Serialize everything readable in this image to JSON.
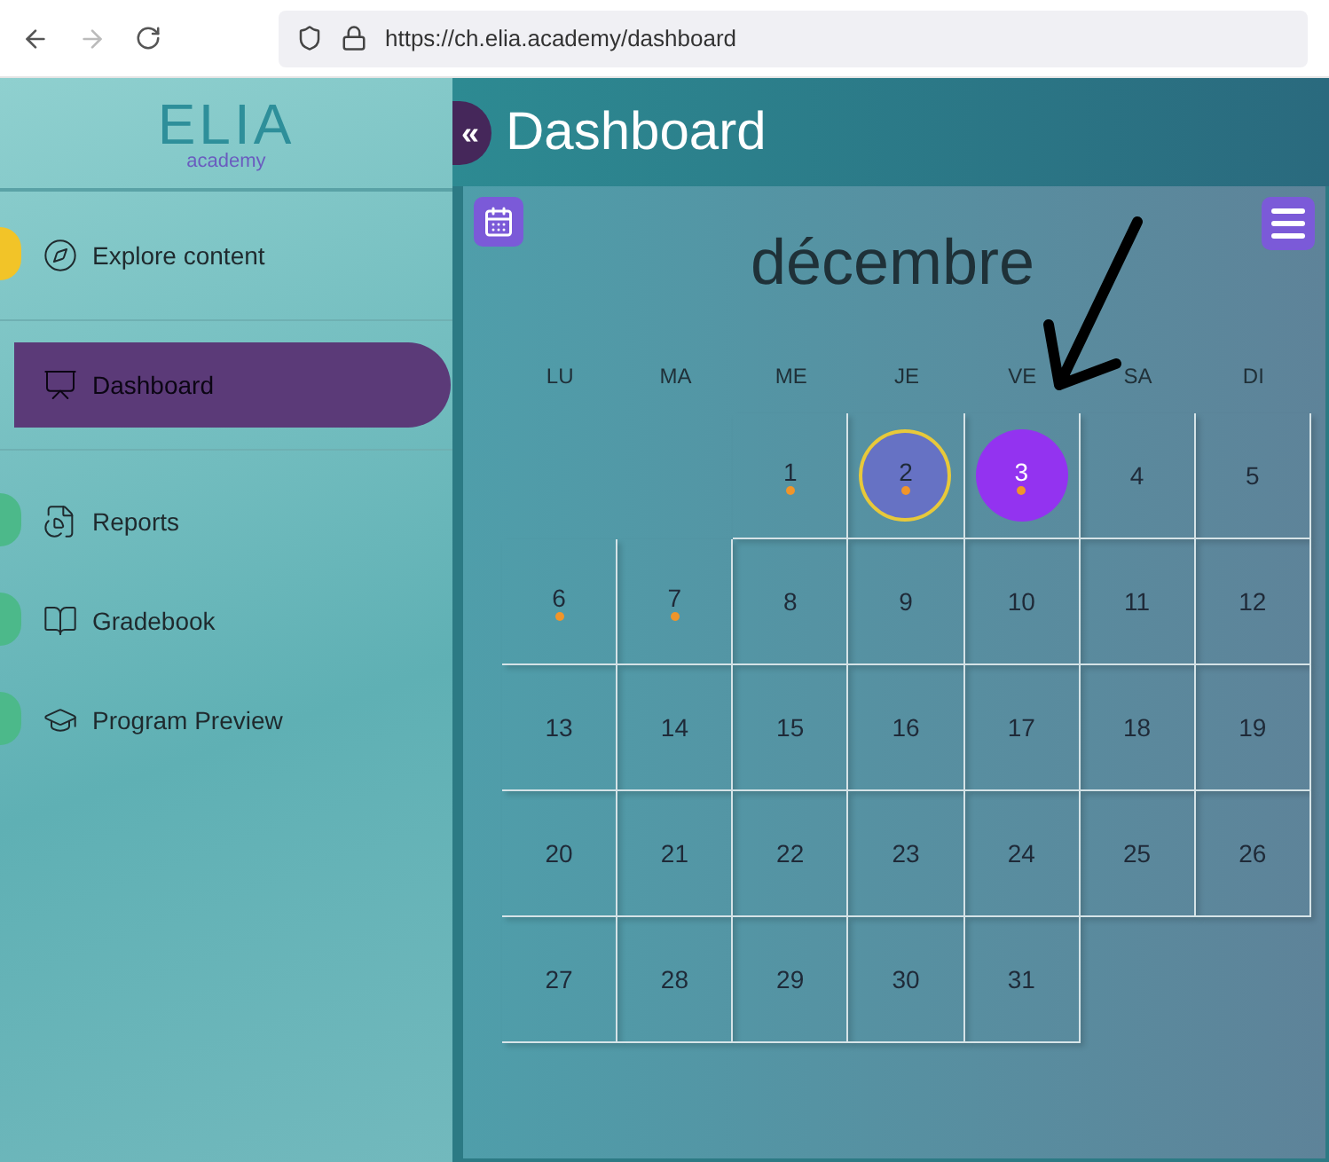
{
  "browser": {
    "url": "https://ch.elia.academy/dashboard",
    "forward_disabled": true
  },
  "sidebar": {
    "logo": {
      "name": "ELIA",
      "tagline": "academy"
    },
    "sections": [
      {
        "items": [
          {
            "label": "Explore content",
            "selected": false,
            "color": "#f2c428"
          }
        ]
      },
      {
        "items": [
          {
            "label": "Dashboard",
            "selected": true
          }
        ]
      },
      {
        "items": [
          {
            "label": "Reports",
            "selected": false,
            "color": "#4cb98a"
          },
          {
            "label": "Gradebook",
            "selected": false,
            "color": "#4cb98a"
          },
          {
            "label": "Program Preview",
            "selected": false,
            "color": "#4cb98a"
          }
        ]
      }
    ]
  },
  "header": {
    "collapse_glyph": "«",
    "title": "Dashboard"
  },
  "calendar": {
    "month": "décembre",
    "weekdays": [
      "LU",
      "MA",
      "ME",
      "JE",
      "VE",
      "SA",
      "DI"
    ],
    "weeks": [
      {
        "days": [
          {
            "day": "1",
            "event": true,
            "today": false,
            "selected": false
          },
          {
            "day": "2",
            "event": true,
            "today": true,
            "selected": false
          },
          {
            "day": "3",
            "event": true,
            "today": false,
            "selected": true
          },
          {
            "day": "4",
            "event": false,
            "today": false,
            "selected": false
          },
          {
            "day": "5",
            "event": false,
            "today": false,
            "selected": false
          }
        ]
      },
      {
        "days": [
          {
            "day": "6",
            "event": true,
            "today": false,
            "selected": false
          },
          {
            "day": "7",
            "event": true,
            "today": false,
            "selected": false
          },
          {
            "day": "8",
            "event": false,
            "today": false,
            "selected": false
          },
          {
            "day": "9",
            "event": false,
            "today": false,
            "selected": false
          },
          {
            "day": "10",
            "event": false,
            "today": false,
            "selected": false
          },
          {
            "day": "11",
            "event": false,
            "today": false,
            "selected": false
          },
          {
            "day": "12",
            "event": false,
            "today": false,
            "selected": false
          }
        ]
      },
      {
        "days": [
          {
            "day": "13",
            "event": false,
            "today": false,
            "selected": false
          },
          {
            "day": "14",
            "event": false,
            "today": false,
            "selected": false
          },
          {
            "day": "15",
            "event": false,
            "today": false,
            "selected": false
          },
          {
            "day": "16",
            "event": false,
            "today": false,
            "selected": false
          },
          {
            "day": "17",
            "event": false,
            "today": false,
            "selected": false
          },
          {
            "day": "18",
            "event": false,
            "today": false,
            "selected": false
          },
          {
            "day": "19",
            "event": false,
            "today": false,
            "selected": false
          }
        ]
      },
      {
        "days": [
          {
            "day": "20",
            "event": false,
            "today": false,
            "selected": false
          },
          {
            "day": "21",
            "event": false,
            "today": false,
            "selected": false
          },
          {
            "day": "22",
            "event": false,
            "today": false,
            "selected": false
          },
          {
            "day": "23",
            "event": false,
            "today": false,
            "selected": false
          },
          {
            "day": "24",
            "event": false,
            "today": false,
            "selected": false
          },
          {
            "day": "25",
            "event": false,
            "today": false,
            "selected": false
          },
          {
            "day": "26",
            "event": false,
            "today": false,
            "selected": false
          }
        ]
      },
      {
        "days": [
          {
            "day": "27",
            "event": false,
            "today": false,
            "selected": false
          },
          {
            "day": "28",
            "event": false,
            "today": false,
            "selected": false
          },
          {
            "day": "29",
            "event": false,
            "today": false,
            "selected": false
          },
          {
            "day": "30",
            "event": false,
            "today": false,
            "selected": false
          },
          {
            "day": "31",
            "event": false,
            "today": false,
            "selected": false
          }
        ]
      }
    ]
  }
}
